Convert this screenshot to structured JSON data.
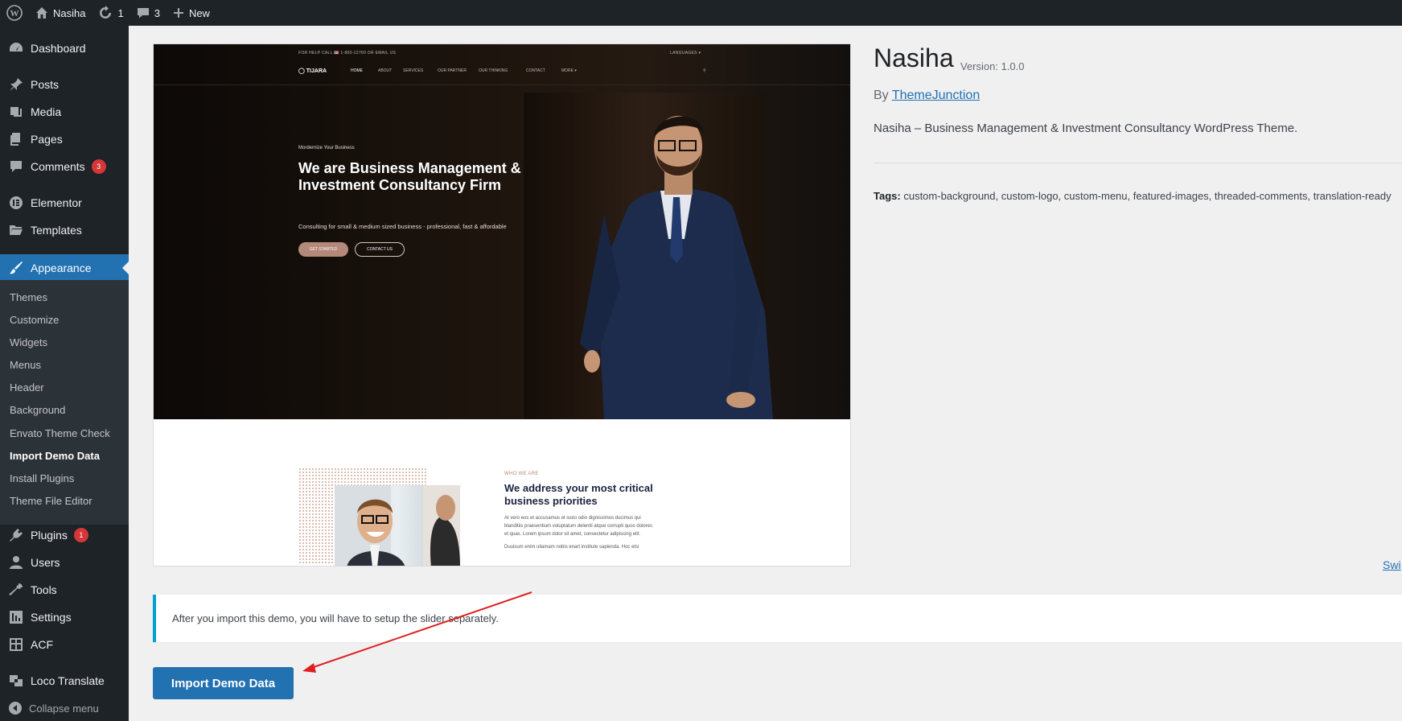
{
  "adminbar": {
    "site_name": "Nasiha",
    "updates_count": "1",
    "comments_count": "3",
    "new_label": "New"
  },
  "sidebar": {
    "dashboard": "Dashboard",
    "posts": "Posts",
    "media": "Media",
    "pages": "Pages",
    "comments": "Comments",
    "comments_badge": "3",
    "elementor": "Elementor",
    "templates": "Templates",
    "appearance": "Appearance",
    "submenu": {
      "themes": "Themes",
      "customize": "Customize",
      "widgets": "Widgets",
      "menus": "Menus",
      "header": "Header",
      "background": "Background",
      "envato": "Envato Theme Check",
      "import": "Import Demo Data",
      "install": "Install Plugins",
      "editor": "Theme File Editor"
    },
    "plugins": "Plugins",
    "plugins_badge": "1",
    "users": "Users",
    "tools": "Tools",
    "settings": "Settings",
    "acf": "ACF",
    "loco": "Loco Translate",
    "collapse": "Collapse menu"
  },
  "preview": {
    "topbar_left": "FOR HELP CALL  🇺🇸  1-800-12769 OR  EMAIL US",
    "topbar_right": "LANGUAGES ▾",
    "logo": "◯ TIJARA",
    "nav": [
      "HOME",
      "ABOUT",
      "SERVICES",
      "OUR PARTNER",
      "OUR THINKING",
      "CONTACT",
      "MORE ▾"
    ],
    "kicker": "Mordernize Your Business",
    "title": "We are Business Management & Investment Consultancy Firm",
    "subtitle": "Consulting for small & medium sized business - professional, fast & affordable",
    "btn_primary": "GET STARTED",
    "btn_secondary": "CONTACT US",
    "who_kicker": "WHO WE ARE",
    "who_title": "We address your most critical business priorities",
    "who_text": "At vero eos et accusamus et iusto odio dignissimos ducimus qui blanditiis praesentium voluptatum deleniti atque corrupti quos dolores et quas. Lorem ipsum dolor sit amet, consectetur adipiscing elit.",
    "who_text2": "Duuisum enim ullamam nobis enart institute sapienda. Hoc etsi"
  },
  "theme": {
    "name": "Nasiha",
    "version": "Version: 1.0.0",
    "by": "By",
    "author": "ThemeJunction",
    "description": "Nasiha – Business Management & Investment Consultancy WordPress Theme.",
    "tags_label": "Tags:",
    "tags": "custom-background, custom-logo, custom-menu, featured-images, threaded-comments, translation-ready",
    "switch_link": "Swi"
  },
  "notice": "After you import this demo, you will have to setup the slider separately.",
  "import_button": "Import Demo Data",
  "colors": {
    "admin_dark": "#1d2327",
    "accent": "#2271b1",
    "badge": "#d63638",
    "annotation_arrow": "#e02020"
  }
}
